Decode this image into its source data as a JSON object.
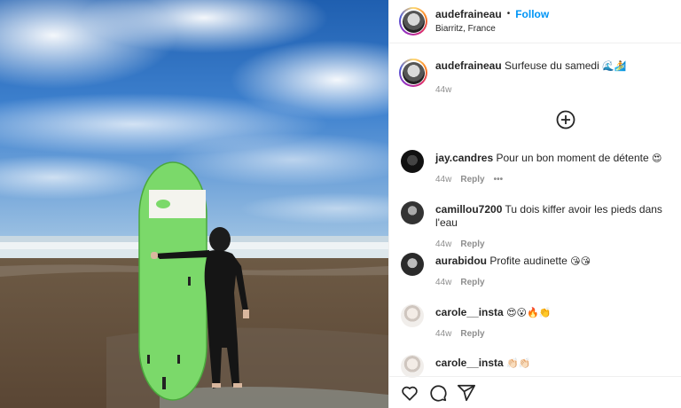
{
  "header": {
    "username": "audefraineau",
    "separator": "•",
    "follow_label": "Follow",
    "location": "Biarritz, France"
  },
  "caption": {
    "username": "audefraineau",
    "text": "Surfeuse du samedi",
    "emoji": "🌊🏄",
    "age": "44w"
  },
  "comments": [
    {
      "username": "jay.candres",
      "text": "Pour un bon moment de détente",
      "emoji": "😍",
      "age": "44w",
      "reply_label": "Reply",
      "more": "•••",
      "avatar_color": "#1a1a1a"
    },
    {
      "username": "camillou7200",
      "text": "Tu dois kiffer avoir les pieds dans l'eau",
      "emoji": "",
      "age": "44w",
      "reply_label": "Reply",
      "avatar_color": "#3b3b3b"
    },
    {
      "username": "aurabidou",
      "text": "Profite audinette",
      "emoji": "😘😘",
      "age": "44w",
      "reply_label": "Reply",
      "avatar_color": "#2c2c2c"
    },
    {
      "username": "carole__insta",
      "text": "",
      "emoji": "😍😮🔥👏",
      "age": "44w",
      "reply_label": "Reply",
      "avatar_color": "#e9e4e0"
    },
    {
      "username": "carole__insta",
      "text": "",
      "emoji": "👏🏻👏🏻",
      "age": "",
      "reply_label": "",
      "avatar_color": "#e9e4e0"
    }
  ],
  "icons": {
    "load_more": "plus-circle-icon",
    "like": "heart-icon",
    "comment": "comment-icon",
    "share": "share-icon"
  },
  "colors": {
    "accent": "#0095f6",
    "board": "#7bd96a",
    "sky": "#2f6db8"
  }
}
